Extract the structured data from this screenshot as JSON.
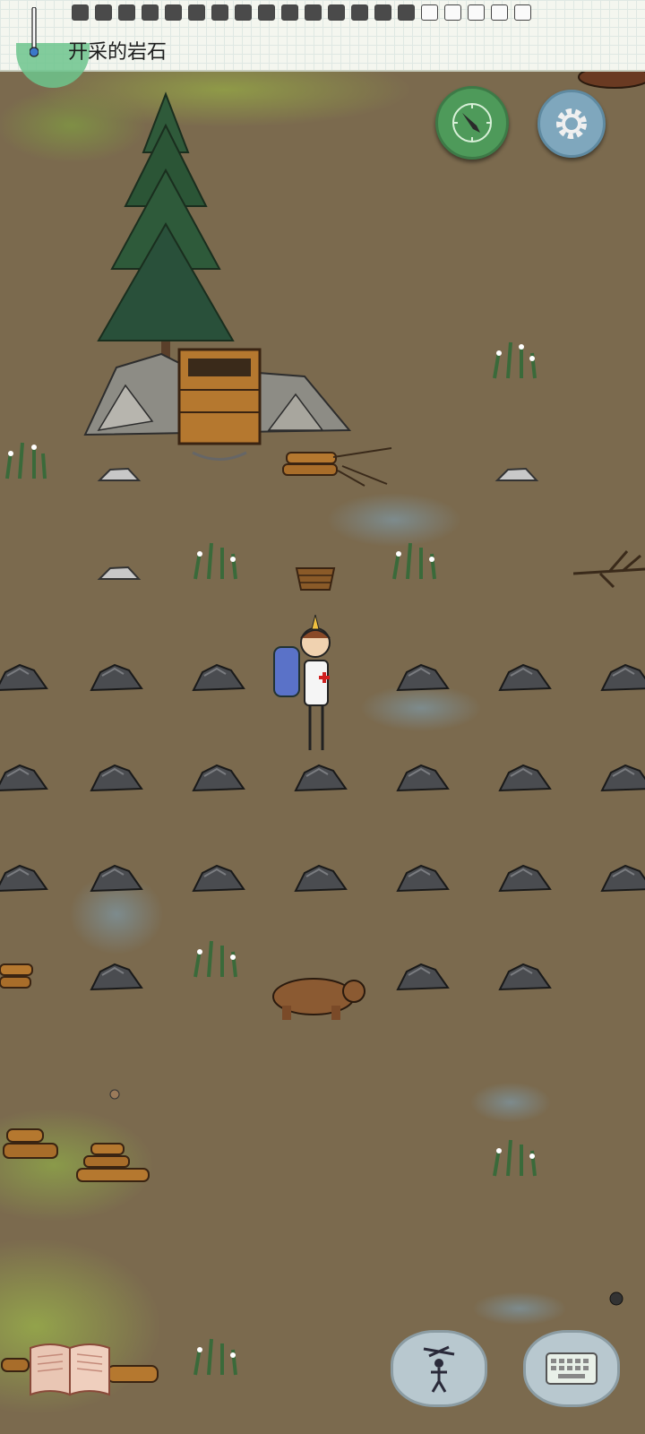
{
  "hud": {
    "status_text": "开采的岩石",
    "inventory_slots": [
      "full",
      "full",
      "full",
      "full",
      "full",
      "full",
      "full",
      "full",
      "full",
      "full",
      "full",
      "full",
      "full",
      "full",
      "full",
      "empty",
      "empty",
      "empty",
      "empty",
      "empty"
    ]
  },
  "buttons": {
    "map": "map-compass-icon",
    "settings": "gear-icon",
    "puppet": "puppet-icon",
    "keyboard": "keyboard-icon",
    "journal": "journal-book-icon"
  },
  "colors": {
    "ground": "#7b6a4e",
    "grass": "#93a34b",
    "map_button": "#4e9a5a",
    "settings_button": "#7fa7bd",
    "bubble_button": "#b8c8cf"
  }
}
